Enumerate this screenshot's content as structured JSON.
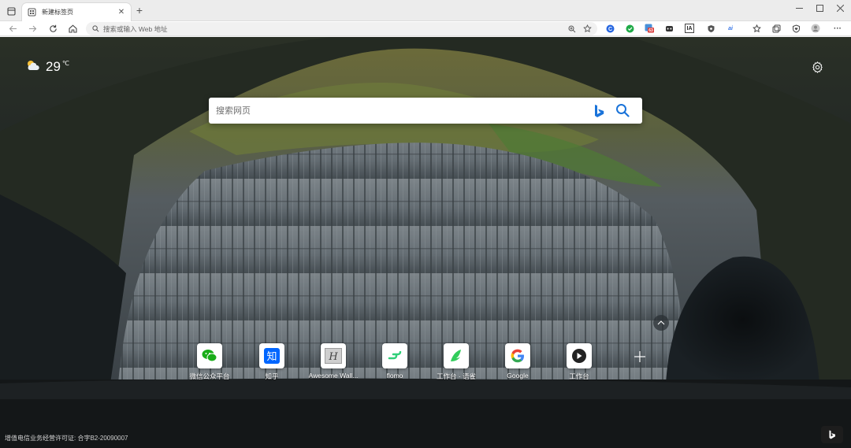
{
  "tab": {
    "title": "新建标签页"
  },
  "addressbar": {
    "placeholder": "搜索或输入 Web 地址"
  },
  "extensions": [
    {
      "name": "copilot-ext",
      "color": "#2867e0"
    },
    {
      "name": "shield-ext",
      "color": "#1faa47"
    },
    {
      "name": "badge-ext",
      "color": "#d83b3b",
      "badge": "63"
    },
    {
      "name": "game-ext",
      "color": "#333333"
    },
    {
      "name": "ia-ext",
      "label": "IA"
    },
    {
      "name": "vpn-ext",
      "color": "#444444"
    },
    {
      "name": "translate-ext",
      "label": "ai",
      "color": "#3b78e7"
    }
  ],
  "weather": {
    "temperature": "29",
    "unit": "℃"
  },
  "search": {
    "placeholder": "搜索网页"
  },
  "quicklinks": [
    {
      "label": "微信公众平台",
      "icon": "wechat-icon",
      "color": "#1aad19"
    },
    {
      "label": "知乎",
      "icon": "zhihu-icon",
      "color": "#0066ff",
      "glyph": "知"
    },
    {
      "label": "Awesome Wall...",
      "icon": "awesome-wallpaper-icon",
      "color": "#777777",
      "glyph": "H"
    },
    {
      "label": "flomo",
      "icon": "flomo-icon",
      "color": "#30cf79"
    },
    {
      "label": "工作台 · 语雀",
      "icon": "yuque-icon",
      "color": "#31cc5b"
    },
    {
      "label": "Google",
      "icon": "google-icon",
      "color": "#4285f4"
    },
    {
      "label": "工作台",
      "icon": "workbench-icon",
      "color": "#222222"
    }
  ],
  "footer": {
    "license": "增值电信业务经营许可证: 合字B2-20090007"
  }
}
